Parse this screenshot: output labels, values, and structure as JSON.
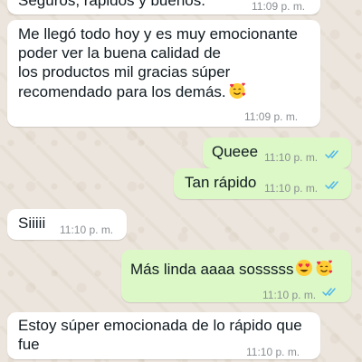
{
  "chat": {
    "messages": [
      {
        "id": "m1",
        "direction": "incoming",
        "text": "Seguros, rápidos y buenos.",
        "time": "11:09 p. m."
      },
      {
        "id": "m2",
        "direction": "incoming",
        "text": "Me llegó todo hoy y es muy emocionante\npoder ver la buena calidad de\nlos productos mil gracias súper\nrecomendado para los demás.",
        "emoji": "smiling-face-with-hearts",
        "time": "11:09 p. m."
      },
      {
        "id": "m3",
        "direction": "outgoing",
        "text": "Queee",
        "time": "11:10 p. m.",
        "status": "read"
      },
      {
        "id": "m4",
        "direction": "outgoing",
        "text": "Tan rápido",
        "time": "11:10 p. m.",
        "status": "read"
      },
      {
        "id": "m5",
        "direction": "incoming",
        "text": "Siiiii",
        "time": "11:10 p. m."
      },
      {
        "id": "m6",
        "direction": "outgoing",
        "text": "Más linda aaaa sosssss",
        "emoji": [
          "heart-eyes",
          "smiling-face-with-hearts"
        ],
        "time": "11:10 p. m.",
        "status": "read"
      },
      {
        "id": "m7",
        "direction": "incoming",
        "text": "Estoy súper emocionada de lo rápido que\nfue",
        "time": "11:10 p. m."
      }
    ]
  },
  "colors": {
    "wallpaper": "#ece5dd",
    "incoming_bubble": "#ffffff",
    "outgoing_bubble": "#dcf8c6",
    "read_ticks": "#4fb6ec",
    "timestamp": "#8a8f93"
  }
}
